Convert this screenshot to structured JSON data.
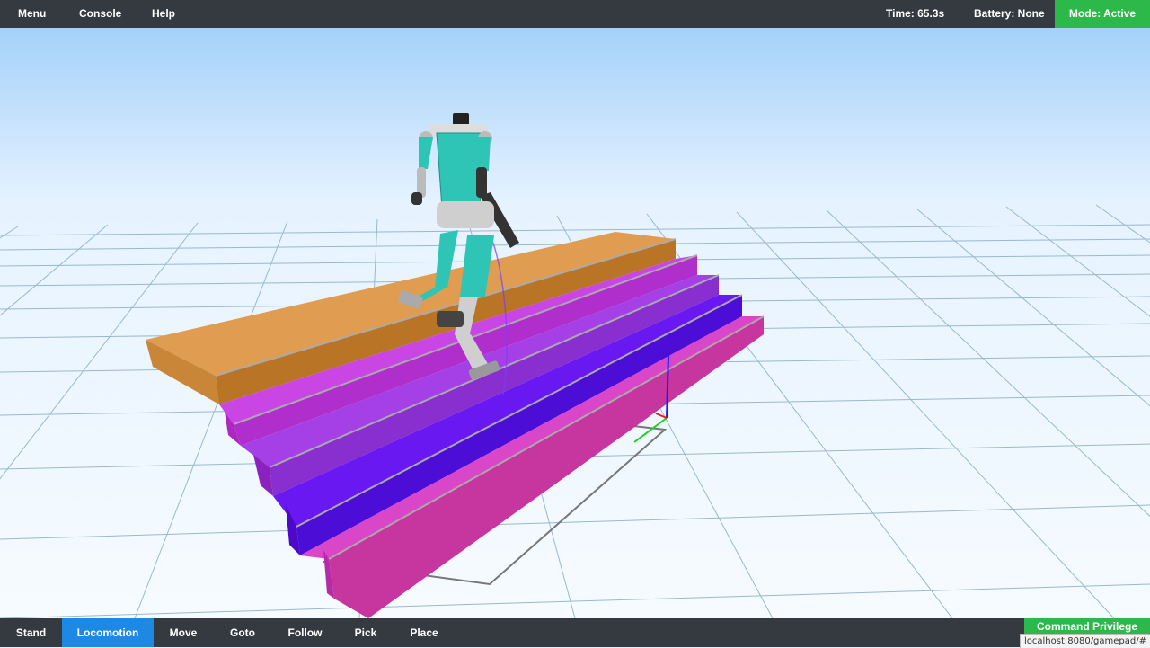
{
  "topbar": {
    "menu_items": [
      "Menu",
      "Console",
      "Help"
    ],
    "time": "Time: 65.3s",
    "battery": "Battery: None",
    "mode": "Mode: Active",
    "mode_color": "#2db84a"
  },
  "bottombar": {
    "buttons": [
      "Stand",
      "Locomotion",
      "Move",
      "Goto",
      "Follow",
      "Pick",
      "Place"
    ],
    "active": "Locomotion",
    "active_color": "#1e88e5",
    "command_privilege": "Command Privilege",
    "command_privilege_color": "#2db84a"
  },
  "url_status": "localhost:8080/gamepad/#",
  "scene": {
    "sky_top": "#a4d1fa",
    "horizon": "#e6f3ff",
    "grid_color": "#9ab8cf",
    "step_colors": [
      "#d9964a",
      "#c23ddb",
      "#9a3ae0",
      "#5a10f0",
      "#d33fbf"
    ],
    "robot_body_color": "#2ec4b6"
  }
}
